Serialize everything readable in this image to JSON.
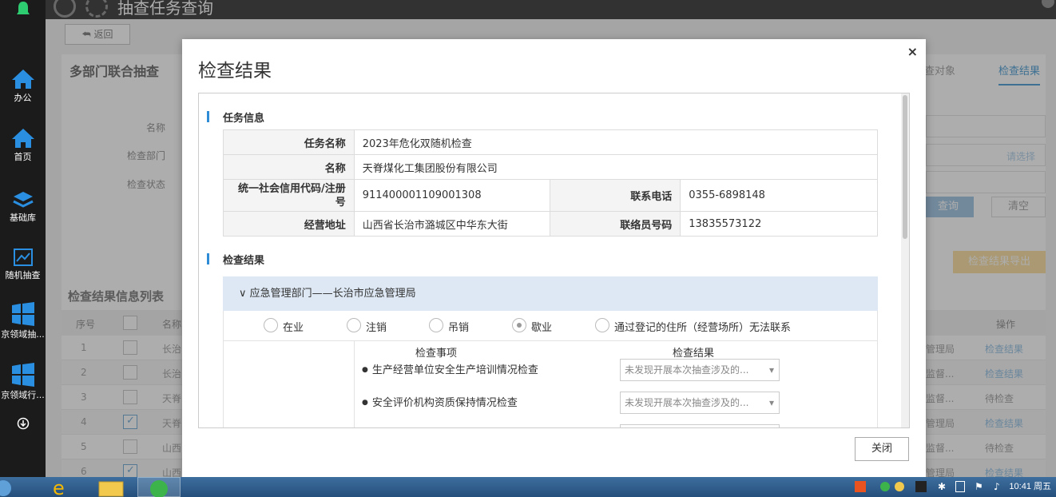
{
  "sidebar": {
    "items": [
      {
        "label": "办公",
        "icon": "home-icon"
      },
      {
        "label": "首页",
        "icon": "home-icon"
      },
      {
        "label": "基础库",
        "icon": "layers-icon"
      },
      {
        "label": "随机抽查",
        "icon": "chart-icon"
      },
      {
        "label": "京领域抽...",
        "icon": "windows-icon"
      },
      {
        "label": "京领域行...",
        "icon": "windows-icon"
      }
    ]
  },
  "topbar": {
    "title": "抽查任务查询"
  },
  "page": {
    "back_label": "⮪ 返回",
    "panel_title": "多部门联合抽查",
    "tabs": [
      "查对象",
      "检查结果"
    ],
    "form": {
      "labels": [
        "名称",
        "检查部门",
        "检查状态"
      ],
      "select_label": "请选择",
      "query_label": "查询",
      "clear_label": "清空",
      "export_label": "检查结果导出"
    },
    "list_title": "检查结果信息列表",
    "columns": [
      "序号",
      "名称",
      "操作"
    ],
    "rows": [
      {
        "no": "1",
        "name": "长治",
        "dept": "管理局",
        "op": "检查结果",
        "checked": false
      },
      {
        "no": "2",
        "name": "长治",
        "dept": "监督...",
        "op": "检查结果",
        "checked": false
      },
      {
        "no": "3",
        "name": "天脊",
        "dept": "监督...",
        "op": "待检查",
        "checked": false
      },
      {
        "no": "4",
        "name": "天脊",
        "dept": "管理局",
        "op": "检查结果",
        "checked": true
      },
      {
        "no": "5",
        "name": "山西",
        "dept": "监督...",
        "op": "待检查",
        "checked": false
      },
      {
        "no": "6",
        "name": "山西",
        "dept": "管理局",
        "op": "检查结果",
        "checked": true
      }
    ]
  },
  "modal": {
    "title": "检查结果",
    "close_x": "×",
    "section_task": "任务信息",
    "section_result": "检查结果",
    "info": {
      "task_name_label": "任务名称",
      "task_name": "2023年危化双随机检查",
      "name_label": "名称",
      "name": "天脊煤化工集团股份有限公司",
      "credit_label": "统一社会信用代码/注册号",
      "credit": "911400001109001308",
      "phone_label": "联系电话",
      "phone": "0355-6898148",
      "address_label": "经营地址",
      "address": "山西省长治市潞城区中华东大街",
      "liaison_label": "联络员号码",
      "liaison": "13835573122"
    },
    "dept": "∨  应急管理部门——长治市应急管理局",
    "statuses": [
      {
        "label": "在业",
        "checked": false
      },
      {
        "label": "注销",
        "checked": false
      },
      {
        "label": "吊销",
        "checked": false
      },
      {
        "label": "歇业",
        "checked": true
      },
      {
        "label": "通过登记的住所（经营场所）无法联系",
        "checked": false
      }
    ],
    "col_item": "检查事项",
    "col_result": "检查结果",
    "items": [
      {
        "label": "生产经营单位安全生产培训情况检查",
        "result": "未发现开展本次抽查涉及的..."
      },
      {
        "label": "安全评价机构资质保持情况检查",
        "result": "未发现开展本次抽查涉及的..."
      }
    ],
    "close_button": "关闭"
  },
  "taskbar": {
    "time": "10:41 周五"
  }
}
